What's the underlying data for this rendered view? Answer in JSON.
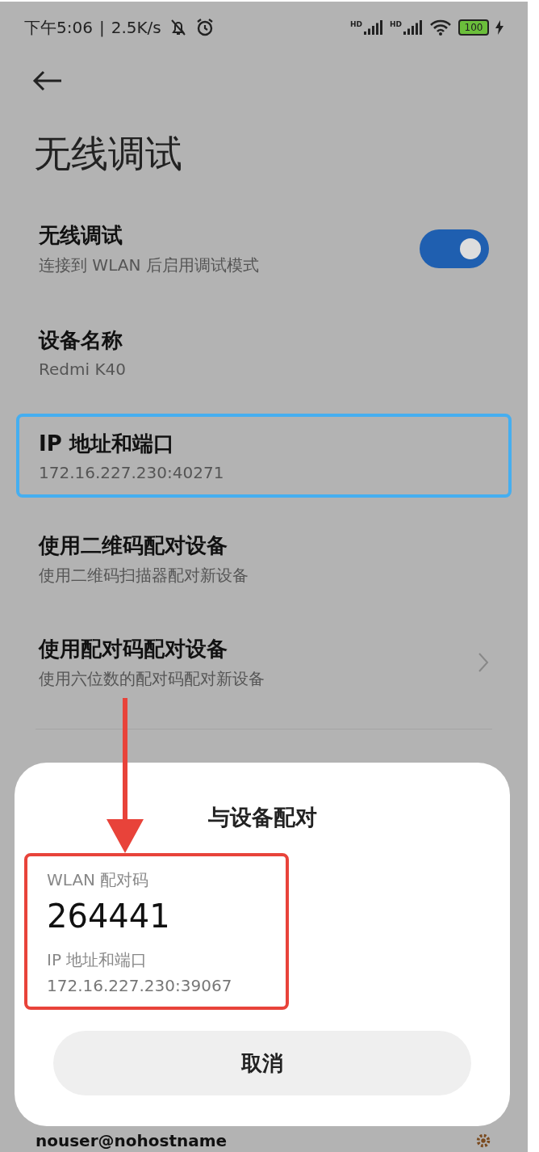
{
  "status_bar": {
    "time": "下午5:06",
    "separator": "|",
    "speed": "2.5K/s",
    "sims": [
      {
        "label": "HD"
      },
      {
        "label": "HD"
      }
    ],
    "battery": "100"
  },
  "title": "无线调试",
  "settings": [
    {
      "kind": "toggle",
      "title": "无线调试",
      "subtitle": "连接到 WLAN 后启用调试模式",
      "on": true,
      "highlighted": false
    },
    {
      "kind": "info",
      "title": "设备名称",
      "subtitle": "Redmi K40",
      "highlighted": false
    },
    {
      "kind": "info",
      "title": "IP 地址和端口",
      "subtitle": "172.16.227.230:40271",
      "highlighted": true
    },
    {
      "kind": "info",
      "title": "使用二维码配对设备",
      "subtitle": "使用二维码扫描器配对新设备",
      "highlighted": false
    },
    {
      "kind": "link",
      "title": "使用配对码配对设备",
      "subtitle": "使用六位数的配对码配对新设备",
      "highlighted": false
    }
  ],
  "account": {
    "name": "nouser@nohostname"
  },
  "dialog": {
    "title": "与设备配对",
    "code_label": "WLAN 配对码",
    "code": "264441",
    "address_label": "IP 地址和端口",
    "address": "172.16.227.230:39067",
    "highlighted": true,
    "cancel": "取消"
  }
}
